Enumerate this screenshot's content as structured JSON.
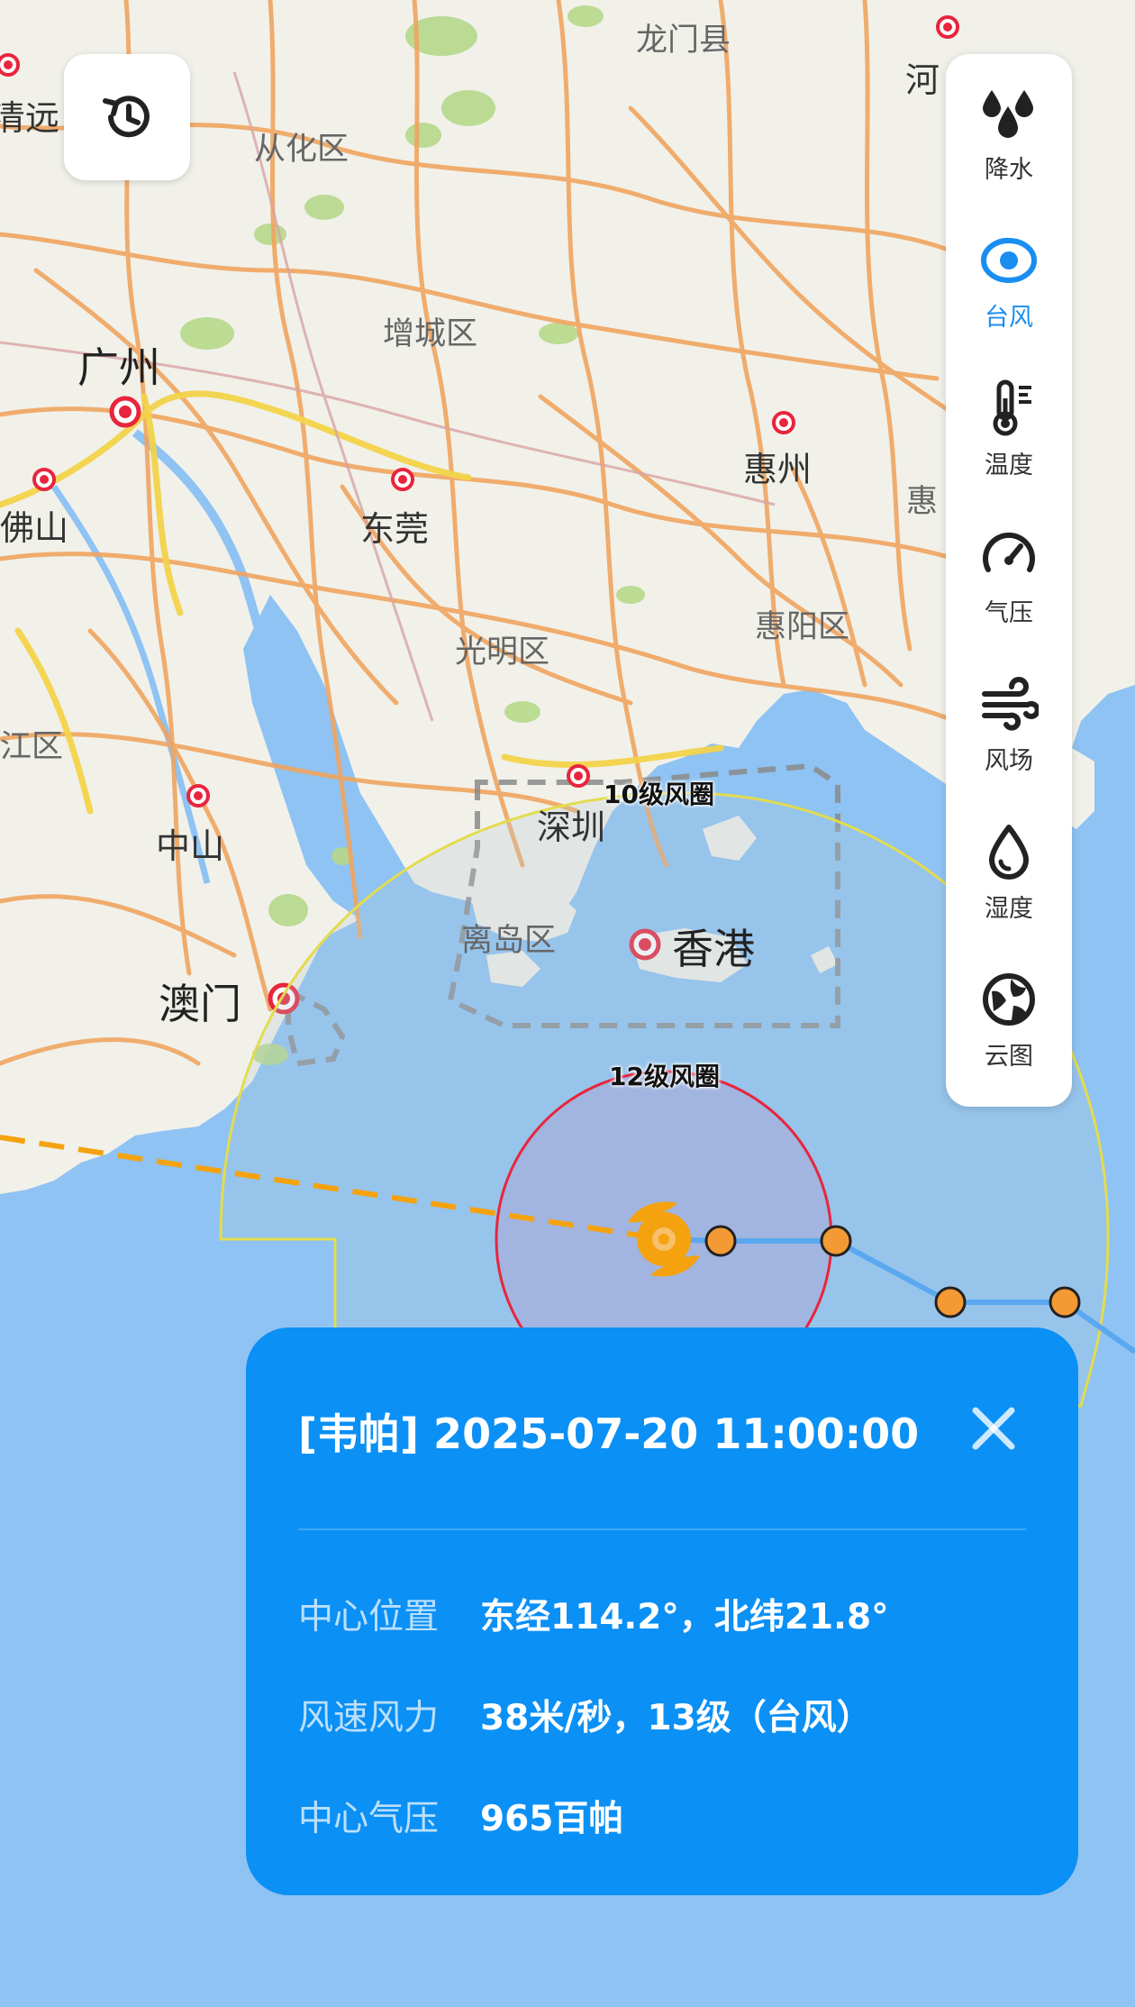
{
  "map": {
    "labels": {
      "longmen": "龙门县",
      "conghua": "从化区",
      "qingyuan_partial": "清远",
      "heyuan_partial": "河",
      "zengcheng": "增城区",
      "guangzhou": "广州",
      "foshan": "佛山",
      "dongguan": "东莞",
      "huizhou": "惠州",
      "hui_partial": "惠",
      "huiyang": "惠阳区",
      "guangming": "光明区",
      "jiangqu_partial": "江区",
      "shenzhen": "深圳",
      "zhongshan": "中山",
      "lidao": "离岛区",
      "hongkong": "香港",
      "macau": "澳门"
    },
    "rings": {
      "level10": "10级风圈",
      "level12": "12级风圈"
    }
  },
  "layers": [
    {
      "label": "降水",
      "icon": "rain-drops-icon",
      "active": false
    },
    {
      "label": "台风",
      "icon": "typhoon-icon",
      "active": true
    },
    {
      "label": "温度",
      "icon": "thermometer-icon",
      "active": false
    },
    {
      "label": "气压",
      "icon": "pressure-gauge-icon",
      "active": false
    },
    {
      "label": "风场",
      "icon": "wind-icon",
      "active": false
    },
    {
      "label": "湿度",
      "icon": "humidity-drop-icon",
      "active": false
    },
    {
      "label": "云图",
      "icon": "globe-icon",
      "active": false
    }
  ],
  "info": {
    "title": "[韦帕] 2025-07-20 11:00:00",
    "rows": [
      {
        "label": "中心位置",
        "value": "东经114.2°，北纬21.8°"
      },
      {
        "label": "风速风力",
        "value": "38米/秒，13级（台风）"
      },
      {
        "label": "中心气压",
        "value": "965百帕"
      }
    ]
  },
  "colors": {
    "accent": "#1a8ef0",
    "card": "#0b90f5",
    "sea": "#8ec3f3",
    "land": "#f1f1ea",
    "road": "#f0a560",
    "ring12": "#e8253d",
    "ring10": "#e3dc4e",
    "track_forecast": "#f5a20f",
    "track_past": "#5aa8f0",
    "track_point": "#f39a34"
  }
}
